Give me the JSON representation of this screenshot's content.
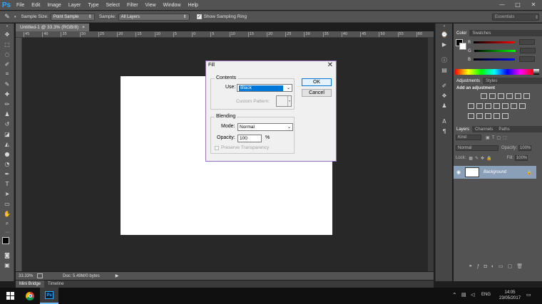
{
  "app": {
    "logo": "Ps",
    "menu": [
      "File",
      "Edit",
      "Image",
      "Layer",
      "Type",
      "Select",
      "Filter",
      "View",
      "Window",
      "Help"
    ],
    "window_controls": {
      "minimize": "—",
      "maximize": "□",
      "close": "✕"
    }
  },
  "options_bar": {
    "sample_size_label": "Sample Size:",
    "sample_size_value": "Point Sample",
    "sample_label": "Sample:",
    "sample_value": "All Layers",
    "sampling_ring_label": "Show Sampling Ring",
    "sampling_ring_checked": true,
    "workspace": "Essentials"
  },
  "document": {
    "tab_title": "Untitled-1 @ 33.3% (RGB/8)",
    "tab_close": "×",
    "zoom": "33.33%",
    "doc_info": "Doc: 5.49M/0 bytes",
    "ruler_labels": [
      "45",
      "40",
      "35",
      "30",
      "25",
      "20",
      "15",
      "10",
      "5",
      "0",
      "5",
      "10",
      "15",
      "20",
      "25",
      "30",
      "35",
      "40",
      "45",
      "50",
      "55",
      "60"
    ]
  },
  "bottom_tabs": [
    "Mini Bridge",
    "Timeline"
  ],
  "panels": {
    "color_tabs": [
      "Color",
      "Swatches"
    ],
    "channels": [
      "R",
      "G",
      "B"
    ],
    "adjust_tabs": [
      "Adjustments",
      "Styles"
    ],
    "add_adjustment": "Add an adjustment",
    "layers_tabs": [
      "Layers",
      "Channels",
      "Paths"
    ],
    "kind_label": "Kind",
    "blend_mode": "Normal",
    "opacity_label": "Opacity:",
    "opacity_value": "100%",
    "lock_label": "Lock:",
    "fill_label": "Fill:",
    "fill_value": "100%",
    "layer_name": "Background"
  },
  "dialog": {
    "title": "Fill",
    "close": "✕",
    "contents_label": "Contents",
    "use_label": "Use:",
    "use_value": "Black",
    "custom_pattern_label": "Custom Pattern:",
    "blending_label": "Blending",
    "mode_label": "Mode:",
    "mode_value": "Normal",
    "opacity_label": "Opacity:",
    "opacity_value": "100",
    "opacity_unit": "%",
    "preserve_label": "Preserve Transparency",
    "ok_label": "OK",
    "cancel_label": "Cancel"
  },
  "taskbar": {
    "time": "14:05",
    "date": "23/05/2017",
    "language": "ENG",
    "ps_label": "Ps"
  },
  "colors": {
    "ui_gray": "#535353",
    "canvas_bg": "#282828",
    "accent": "#0078d7",
    "dialog_border": "#9b6fb8"
  }
}
